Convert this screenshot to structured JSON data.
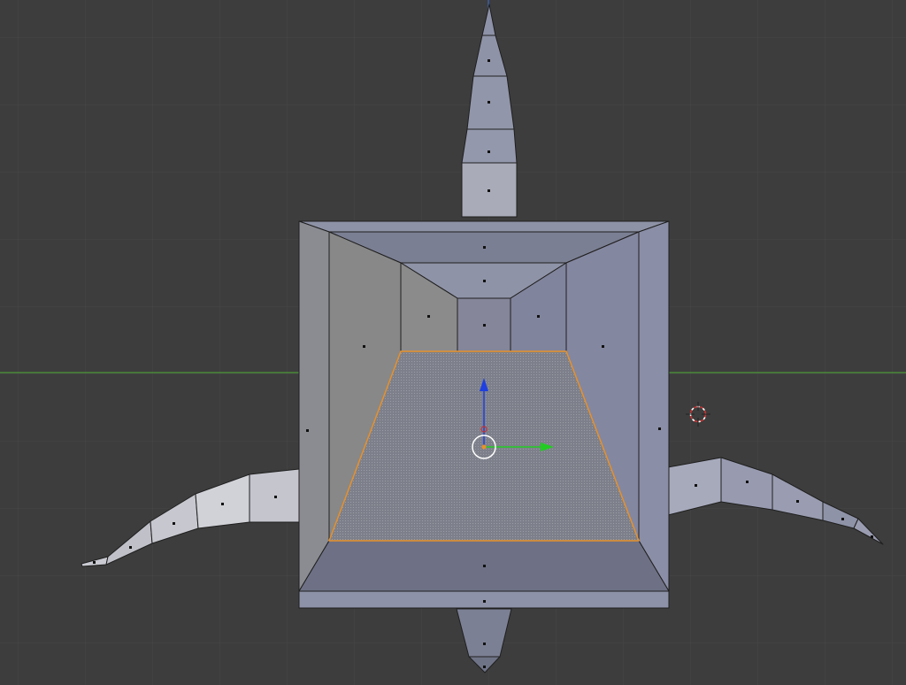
{
  "viewport": {
    "background": "#3d3d3d",
    "grid_color": "#474747",
    "x_axis_color": "#4a8a3a",
    "z_axis_color": "#3b5fa8"
  },
  "mesh": {
    "face_color": "#8f93a8",
    "dark_face_color": "#6f7386",
    "light_face_color": "#c9cad2",
    "edge_color": "#1f1f1f",
    "selected_edge_color": "#e8912b"
  },
  "gizmo": {
    "z_arrow_color": "#1f3fe0",
    "y_arrow_color": "#22cc22",
    "pivot_color": "#ffffff"
  },
  "cursor_3d": {
    "ring_color": "#c83232"
  }
}
